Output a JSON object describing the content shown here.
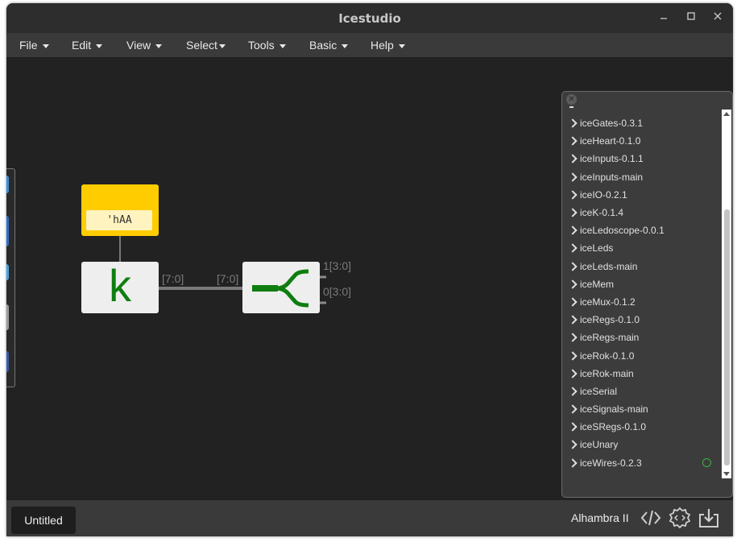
{
  "window": {
    "title": "Icestudio"
  },
  "menubar": {
    "items": [
      {
        "label": "File"
      },
      {
        "label": "Edit"
      },
      {
        "label": "View"
      },
      {
        "label": "Select"
      },
      {
        "label": "Tools"
      },
      {
        "label": "Basic"
      },
      {
        "label": "Help"
      }
    ]
  },
  "canvas": {
    "constant_value": "'hAA",
    "constant_letter": "k",
    "wires": {
      "k_out": "[7:0]",
      "split_in": "[7:0]",
      "split_out_1": "1[3:0]",
      "split_out_0": "0[3:0]"
    }
  },
  "collections": {
    "items": [
      {
        "label": "iceGates-0.3.1"
      },
      {
        "label": "iceHeart-0.1.0"
      },
      {
        "label": "iceInputs-0.1.1"
      },
      {
        "label": "iceInputs-main"
      },
      {
        "label": "iceIO-0.2.1"
      },
      {
        "label": "iceK-0.1.4"
      },
      {
        "label": "iceLedoscope-0.0.1"
      },
      {
        "label": "iceLeds"
      },
      {
        "label": "iceLeds-main"
      },
      {
        "label": "iceMem"
      },
      {
        "label": "iceMux-0.1.2"
      },
      {
        "label": "iceRegs-0.1.0"
      },
      {
        "label": "iceRegs-main"
      },
      {
        "label": "iceRok-0.1.0"
      },
      {
        "label": "iceRok-main"
      },
      {
        "label": "iceSerial"
      },
      {
        "label": "iceSignals-main"
      },
      {
        "label": "iceSRegs-0.1.0"
      },
      {
        "label": "iceUnary"
      },
      {
        "label": "iceWires-0.2.3"
      }
    ]
  },
  "footer": {
    "file_tab": "Untitled",
    "board": "Alhambra II"
  },
  "colors": {
    "accent_green": "#0f7d0f",
    "constant_yellow": "#ffcc00",
    "status_green": "#3cb43c"
  }
}
